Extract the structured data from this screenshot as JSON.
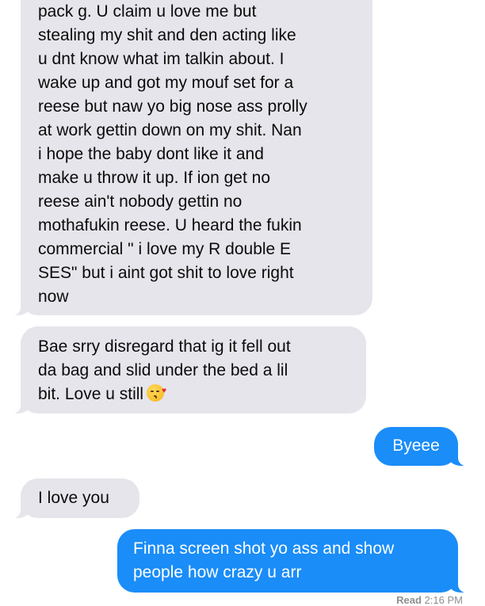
{
  "conversation": {
    "messages": [
      {
        "direction": "incoming",
        "lines": [
          "pack g.  U claim u love me but",
          "stealing my shit and den acting like",
          "u dnt know what im talkin about. I",
          "wake up and got my mouf set for a",
          "reese but naw yo big nose ass prolly",
          "at work gettin down on my shit. Nan",
          "i hope the baby dont like it and",
          "make u throw it up. If ion get no",
          "reese ain't nobody gettin no",
          "mothafukin reese. U heard the fukin",
          "commercial \" i love my R double E",
          "SES\" but i aint got shit to love right",
          "now"
        ]
      },
      {
        "direction": "incoming",
        "lines": [
          "Bae srry disregard that ig it fell out",
          "da bag and slid under the bed a lil",
          "bit. Love u still"
        ],
        "emoji": "face-blowing-a-kiss-emoji"
      },
      {
        "direction": "outgoing",
        "text": "Byeee"
      },
      {
        "direction": "incoming",
        "text": "I love you"
      },
      {
        "direction": "outgoing",
        "lines": [
          "Finna screen shot yo ass and show",
          "people how crazy u arr"
        ]
      }
    ],
    "receipt": {
      "label": "Read",
      "time": "2:16 PM"
    }
  },
  "colors": {
    "incoming_bubble": "#e6e5eb",
    "outgoing_bubble": "#1a8df8",
    "incoming_text": "#0b0b0b",
    "outgoing_text": "#ffffff",
    "receipt_text": "#8e8e93"
  }
}
